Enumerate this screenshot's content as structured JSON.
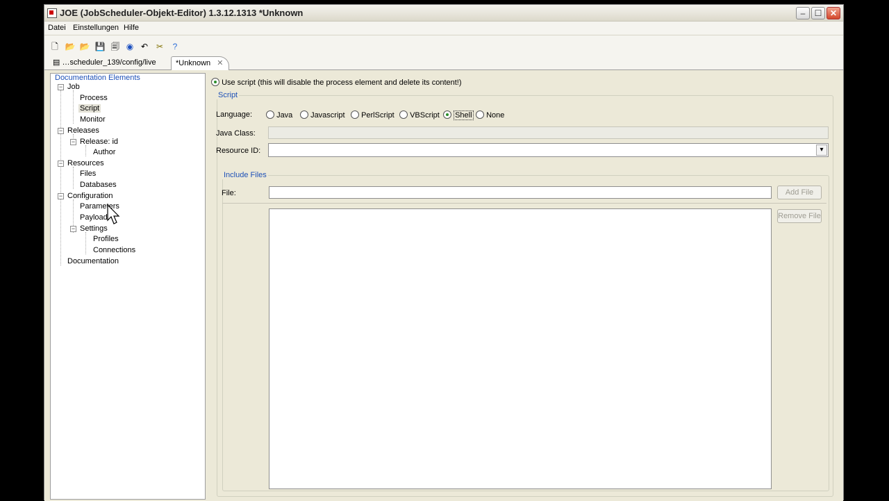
{
  "window": {
    "title": "JOE (JobScheduler-Objekt-Editor) 1.3.12.1313 *Unknown"
  },
  "menu": [
    "Datei",
    "Einstellungen",
    "Hilfe"
  ],
  "tabs": [
    {
      "label": "…scheduler_139/config/live",
      "active": false
    },
    {
      "label": "*Unknown",
      "active": true
    }
  ],
  "tree": {
    "header": "Documentation Elements",
    "items": {
      "job": "Job",
      "process": "Process",
      "script": "Script",
      "monitor": "Monitor",
      "releases": "Releases",
      "release_id": "Release: id",
      "author": "Author",
      "resources": "Resources",
      "files": "Files",
      "databases": "Databases",
      "configuration": "Configuration",
      "parameters": "Parameters",
      "payload": "Payload",
      "settings": "Settings",
      "profiles": "Profiles",
      "connections": "Connections",
      "documentation": "Documentation"
    },
    "selected": "Script"
  },
  "script_form": {
    "use_script_label": "Use script (this will disable the process element and delete its content!)",
    "group_label": "Script",
    "language_label": "Language:",
    "languages": [
      "Java",
      "Javascript",
      "PerlScript",
      "VBScript",
      "Shell",
      "None"
    ],
    "selected_language": "Shell",
    "java_class_label": "Java Class:",
    "java_class_value": "",
    "resource_id_label": "Resource ID:",
    "resource_id_value": ""
  },
  "include_files": {
    "group_label": "Include Files",
    "file_label": "File:",
    "file_value": "",
    "add_button": "Add File",
    "remove_button": "Remove File"
  }
}
